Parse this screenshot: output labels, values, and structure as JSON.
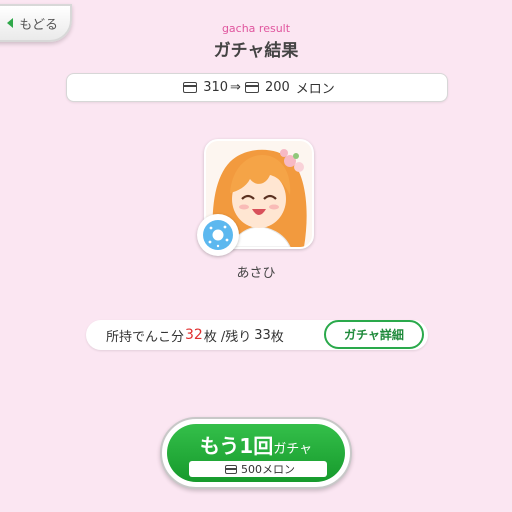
{
  "header": {
    "back_label": "もどる",
    "subtitle": "gacha result",
    "title": "ガチャ結果"
  },
  "cost_bar": {
    "before": "310",
    "arrow": "⇒",
    "after": "200",
    "unit": "メロン"
  },
  "result": {
    "character_name": "あさひ"
  },
  "stock": {
    "label": "所持でんこ分",
    "owned": "32",
    "owned_unit": "枚",
    "remaining_label": "/残り",
    "remaining": "33",
    "remaining_unit": "枚"
  },
  "detail_button": {
    "label": "ガチャ詳細"
  },
  "again_button": {
    "main": "もう1回",
    "suffix": "ガチャ",
    "cost": "500",
    "cost_unit": "メロン"
  },
  "colors": {
    "background": "#fbe6f2",
    "accent_green": "#2aa94b",
    "subtitle_pink": "#e0559e",
    "highlight_red": "#e03030"
  },
  "icons": [
    "back-arrow-icon",
    "card-icon",
    "donut-icon"
  ]
}
